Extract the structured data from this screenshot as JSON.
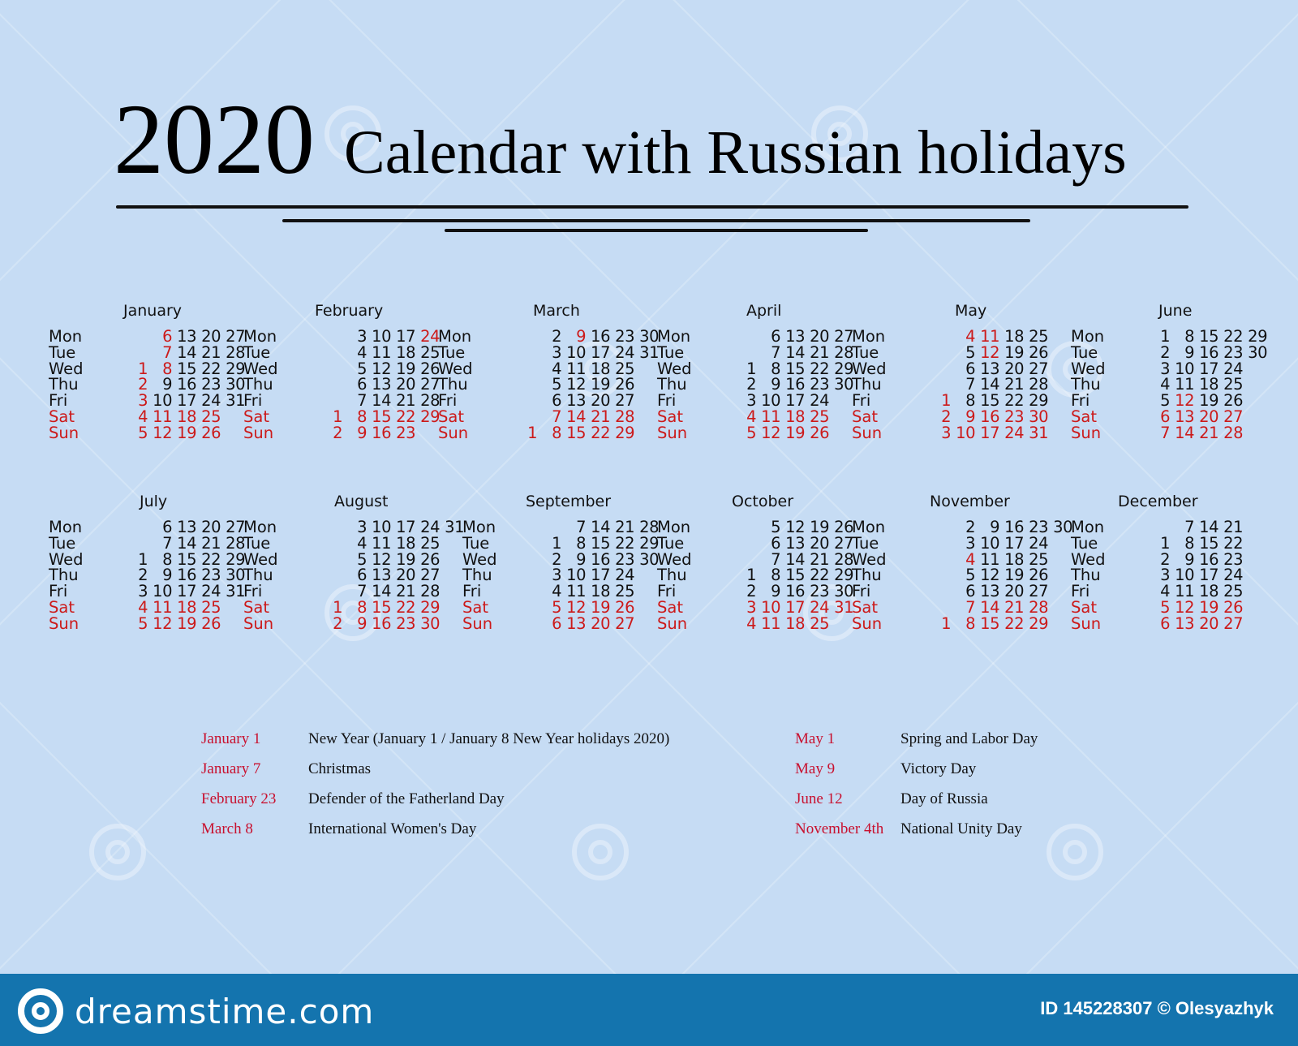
{
  "header": {
    "year": "2020",
    "title": "Calendar with Russian holidays"
  },
  "weekdays": [
    "Mon",
    "Tue",
    "Wed",
    "Thu",
    "Fri",
    "Sat",
    "Sun"
  ],
  "colors": {
    "background": "#c6dcf4",
    "holiday_red": "#cc1a1a",
    "text": "#111111",
    "footer": "#1474ae"
  },
  "months": [
    {
      "name": "January",
      "rows": [
        [
          null,
          6,
          13,
          20,
          27
        ],
        [
          null,
          7,
          14,
          21,
          28
        ],
        [
          1,
          8,
          15,
          22,
          29
        ],
        [
          2,
          9,
          16,
          23,
          30
        ],
        [
          3,
          10,
          17,
          24,
          31
        ],
        [
          4,
          11,
          18,
          25,
          null
        ],
        [
          5,
          12,
          19,
          26,
          null
        ]
      ],
      "red_days": [
        1,
        2,
        3,
        6,
        7,
        8
      ]
    },
    {
      "name": "February",
      "rows": [
        [
          null,
          3,
          10,
          17,
          24
        ],
        [
          null,
          4,
          11,
          18,
          25
        ],
        [
          null,
          5,
          12,
          19,
          26
        ],
        [
          null,
          6,
          13,
          20,
          27
        ],
        [
          null,
          7,
          14,
          21,
          28
        ],
        [
          1,
          8,
          15,
          22,
          29
        ],
        [
          2,
          9,
          16,
          23,
          null
        ]
      ],
      "red_days": [
        24
      ]
    },
    {
      "name": "March",
      "rows": [
        [
          null,
          2,
          9,
          16,
          23,
          30
        ],
        [
          null,
          3,
          10,
          17,
          24,
          31
        ],
        [
          null,
          4,
          11,
          18,
          25,
          null
        ],
        [
          null,
          5,
          12,
          19,
          26,
          null
        ],
        [
          null,
          6,
          13,
          20,
          27,
          null
        ],
        [
          null,
          7,
          14,
          21,
          28,
          null
        ],
        [
          1,
          8,
          15,
          22,
          29,
          null
        ]
      ],
      "red_days": [
        9
      ]
    },
    {
      "name": "April",
      "rows": [
        [
          null,
          6,
          13,
          20,
          27
        ],
        [
          null,
          7,
          14,
          21,
          28
        ],
        [
          1,
          8,
          15,
          22,
          29
        ],
        [
          2,
          9,
          16,
          23,
          30
        ],
        [
          3,
          10,
          17,
          24,
          null
        ],
        [
          4,
          11,
          18,
          25,
          null
        ],
        [
          5,
          12,
          19,
          26,
          null
        ]
      ],
      "red_days": []
    },
    {
      "name": "May",
      "rows": [
        [
          null,
          4,
          11,
          18,
          25
        ],
        [
          null,
          5,
          12,
          19,
          26
        ],
        [
          null,
          6,
          13,
          20,
          27
        ],
        [
          null,
          7,
          14,
          21,
          28
        ],
        [
          1,
          8,
          15,
          22,
          29
        ],
        [
          2,
          9,
          16,
          23,
          30
        ],
        [
          3,
          10,
          17,
          24,
          31
        ]
      ],
      "red_days": [
        1,
        4,
        11,
        12
      ]
    },
    {
      "name": "June",
      "rows": [
        [
          1,
          8,
          15,
          22,
          29
        ],
        [
          2,
          9,
          16,
          23,
          30
        ],
        [
          3,
          10,
          17,
          24,
          null
        ],
        [
          4,
          11,
          18,
          25,
          null
        ],
        [
          5,
          12,
          19,
          26,
          null
        ],
        [
          6,
          13,
          20,
          27,
          null
        ],
        [
          7,
          14,
          21,
          28,
          null
        ]
      ],
      "red_days": [
        12
      ]
    },
    {
      "name": "July",
      "rows": [
        [
          null,
          6,
          13,
          20,
          27
        ],
        [
          null,
          7,
          14,
          21,
          28
        ],
        [
          1,
          8,
          15,
          22,
          29
        ],
        [
          2,
          9,
          16,
          23,
          30
        ],
        [
          3,
          10,
          17,
          24,
          31
        ],
        [
          4,
          11,
          18,
          25,
          null
        ],
        [
          5,
          12,
          19,
          26,
          null
        ]
      ],
      "red_days": []
    },
    {
      "name": "August",
      "rows": [
        [
          null,
          3,
          10,
          17,
          24,
          31
        ],
        [
          null,
          4,
          11,
          18,
          25,
          null
        ],
        [
          null,
          5,
          12,
          19,
          26,
          null
        ],
        [
          null,
          6,
          13,
          20,
          27,
          null
        ],
        [
          null,
          7,
          14,
          21,
          28,
          null
        ],
        [
          1,
          8,
          15,
          22,
          29,
          null
        ],
        [
          2,
          9,
          16,
          23,
          30,
          null
        ]
      ],
      "red_days": []
    },
    {
      "name": "September",
      "rows": [
        [
          null,
          7,
          14,
          21,
          28
        ],
        [
          1,
          8,
          15,
          22,
          29
        ],
        [
          2,
          9,
          16,
          23,
          30
        ],
        [
          3,
          10,
          17,
          24,
          null
        ],
        [
          4,
          11,
          18,
          25,
          null
        ],
        [
          5,
          12,
          19,
          26,
          null
        ],
        [
          6,
          13,
          20,
          27,
          null
        ]
      ],
      "red_days": []
    },
    {
      "name": "October",
      "rows": [
        [
          null,
          5,
          12,
          19,
          26
        ],
        [
          null,
          6,
          13,
          20,
          27
        ],
        [
          null,
          7,
          14,
          21,
          28
        ],
        [
          1,
          8,
          15,
          22,
          29
        ],
        [
          2,
          9,
          16,
          23,
          30
        ],
        [
          3,
          10,
          17,
          24,
          31
        ],
        [
          4,
          11,
          18,
          25,
          null
        ]
      ],
      "red_days": []
    },
    {
      "name": "November",
      "rows": [
        [
          null,
          2,
          9,
          16,
          23,
          30
        ],
        [
          null,
          3,
          10,
          17,
          24,
          null
        ],
        [
          null,
          4,
          11,
          18,
          25,
          null
        ],
        [
          null,
          5,
          12,
          19,
          26,
          null
        ],
        [
          null,
          6,
          13,
          20,
          27,
          null
        ],
        [
          null,
          7,
          14,
          21,
          28,
          null
        ],
        [
          1,
          8,
          15,
          22,
          29,
          null
        ]
      ],
      "red_days": [
        4
      ]
    },
    {
      "name": "December",
      "rows": [
        [
          null,
          7,
          14,
          21
        ],
        [
          1,
          8,
          15,
          22
        ],
        [
          2,
          9,
          16,
          23
        ],
        [
          3,
          10,
          17,
          24
        ],
        [
          4,
          11,
          18,
          25
        ],
        [
          5,
          12,
          19,
          26
        ],
        [
          6,
          13,
          20,
          27
        ]
      ],
      "red_days": []
    }
  ],
  "holidays_left": [
    {
      "date": "January 1",
      "name": "New Year (January 1 / January 8 New Year holidays 2020)"
    },
    {
      "date": "January 7",
      "name": "Christmas"
    },
    {
      "date": "February 23",
      "name": "Defender of the Fatherland Day"
    },
    {
      "date": "March 8",
      "name": "International Women's Day"
    }
  ],
  "holidays_right": [
    {
      "date": "May 1",
      "name": "Spring and Labor Day"
    },
    {
      "date": "May 9",
      "name": "Victory Day"
    },
    {
      "date": "June 12",
      "name": "Day of Russia"
    },
    {
      "date": "November 4th",
      "name": "National Unity Day"
    }
  ],
  "footer": {
    "logo_text": "dreamstime.com",
    "credit": "ID 145228307 © Olesyazhyk"
  }
}
